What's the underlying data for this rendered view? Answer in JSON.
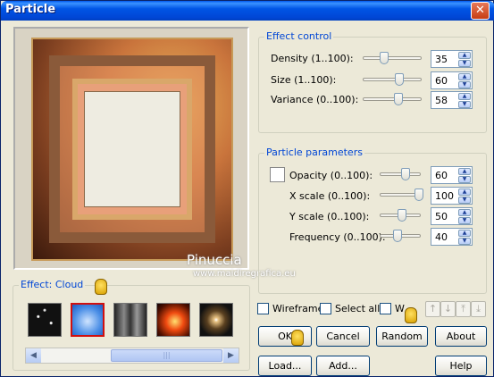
{
  "window": {
    "title": "Particle",
    "close": "✕"
  },
  "watermark": {
    "line1": "Pinuccia",
    "line2": "www.maidiregrafica.eu"
  },
  "effect_control": {
    "title": "Effect control",
    "rows": [
      {
        "label": "Density (1..100):",
        "value": "35",
        "level": 0.35
      },
      {
        "label": "Size (1..100):",
        "value": "60",
        "level": 0.6
      },
      {
        "label": "Variance (0..100):",
        "value": "58",
        "level": 0.58
      }
    ]
  },
  "particle_parameters": {
    "title": "Particle parameters",
    "rows": [
      {
        "label": "Opacity (0..100):",
        "value": "60",
        "level": 0.6
      },
      {
        "label": "X scale (0..100):",
        "value": "100",
        "level": 1.0
      },
      {
        "label": "Y scale (0..100):",
        "value": "50",
        "level": 0.5
      },
      {
        "label": "Frequency (0..100):",
        "value": "40",
        "level": 0.4
      }
    ]
  },
  "effect_group": {
    "title": "Effect: Cloud"
  },
  "options": {
    "wireframe": "Wireframe",
    "select_all": "Select all",
    "w": "W"
  },
  "buttons": {
    "ok": "OK",
    "cancel": "Cancel",
    "random": "Random",
    "about": "About",
    "load": "Load...",
    "add": "Add...",
    "help": "Help"
  },
  "arrows": [
    "↑",
    "↓",
    "⤒",
    "⤓"
  ],
  "colors": {
    "title_blue": "#0058ee",
    "group_label": "#0046d5",
    "selected_border": "#d01010"
  }
}
